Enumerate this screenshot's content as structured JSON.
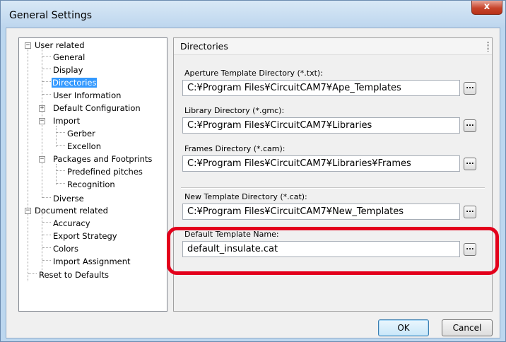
{
  "window": {
    "title": "General Settings",
    "close_glyph": "x"
  },
  "tree": {
    "items": [
      {
        "label": "User related",
        "expander": "−"
      },
      {
        "label": "General"
      },
      {
        "label": "Display"
      },
      {
        "label": "Directories",
        "selected": true
      },
      {
        "label": "User Information"
      },
      {
        "label": "Default Configuration",
        "expander": "+"
      },
      {
        "label": "Import",
        "expander": "−"
      },
      {
        "label": "Gerber"
      },
      {
        "label": "Excellon"
      },
      {
        "label": "Packages and Footprints",
        "expander": "−"
      },
      {
        "label": "Predefined pitches"
      },
      {
        "label": "Recognition"
      },
      {
        "label": "Diverse"
      },
      {
        "label": "Document related",
        "expander": "−"
      },
      {
        "label": "Accuracy"
      },
      {
        "label": "Export Strategy"
      },
      {
        "label": "Colors"
      },
      {
        "label": "Import Assignment"
      },
      {
        "label": "Reset to Defaults"
      }
    ]
  },
  "panel": {
    "title": "Directories",
    "fields": [
      {
        "label": "Aperture Template Directory (*.txt):",
        "value": "C:¥Program Files¥CircuitCAM7¥Ape_Templates",
        "button": "..."
      },
      {
        "label": "Library  Directory (*.gmc):",
        "value": "C:¥Program Files¥CircuitCAM7¥Libraries",
        "button": "..."
      },
      {
        "label": "Frames Directory (*.cam):",
        "value": "C:¥Program Files¥CircuitCAM7¥Libraries¥Frames",
        "button": "..."
      },
      {
        "label": "New Template Directory (*.cat):",
        "value": "C:¥Program Files¥CircuitCAM7¥New_Templates",
        "button": "..."
      },
      {
        "label": "Default Template Name:",
        "value": "default_insulate.cat",
        "button": "..."
      }
    ]
  },
  "buttons": {
    "ok": "OK",
    "cancel": "Cancel"
  },
  "colors": {
    "highlight": "#e3001b",
    "selection": "#3399ff"
  }
}
